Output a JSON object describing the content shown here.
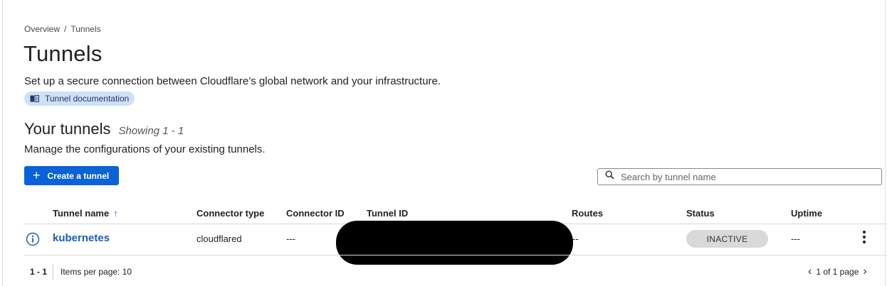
{
  "breadcrumb": {
    "root": "Overview",
    "separator": "/",
    "current": "Tunnels"
  },
  "page": {
    "title": "Tunnels",
    "description": "Set up a secure connection between Cloudflare’s global network and your infrastructure.",
    "doc_link": "Tunnel documentation"
  },
  "section": {
    "title": "Your tunnels",
    "showing": "Showing 1 - 1",
    "description": "Manage the configurations of your existing tunnels."
  },
  "toolbar": {
    "create_label": "Create a tunnel",
    "search_placeholder": "Search by tunnel name"
  },
  "table": {
    "headers": {
      "name": "Tunnel name",
      "connector_type": "Connector type",
      "connector_id": "Connector ID",
      "tunnel_id": "Tunnel ID",
      "routes": "Routes",
      "status": "Status",
      "uptime": "Uptime"
    },
    "rows": [
      {
        "name": "kubernetes",
        "connector_type": "cloudflared",
        "connector_id": "---",
        "routes": "--",
        "status": "INACTIVE",
        "uptime": "---"
      }
    ]
  },
  "footer": {
    "range": "1 - 1",
    "items_per_page": "Items per page: 10",
    "page_info": "1 of 1 page"
  },
  "colors": {
    "accent": "#0b62d6",
    "link": "#1a5fb4",
    "doc_pill_bg": "#cfe0f7",
    "status_inactive_bg": "#d9d9d9"
  },
  "icons": {
    "doc": "book-icon",
    "create": "plus-icon",
    "search": "search-icon",
    "sort": "arrow-up-icon",
    "info": "info-icon",
    "menu": "kebab-menu-icon",
    "prev": "chevron-left-icon",
    "next": "chevron-right-icon"
  }
}
